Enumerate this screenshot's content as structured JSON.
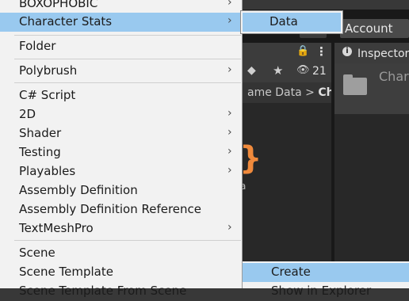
{
  "menu": {
    "items": [
      {
        "label": "BOXOPHOBIC",
        "arrow": "›"
      },
      {
        "label": "Character Stats",
        "arrow": "›"
      },
      {
        "label": "Folder",
        "arrow": ""
      },
      {
        "label": "Polybrush",
        "arrow": "›"
      },
      {
        "label": "C# Script",
        "arrow": ""
      },
      {
        "label": "2D",
        "arrow": "›"
      },
      {
        "label": "Shader",
        "arrow": "›"
      },
      {
        "label": "Testing",
        "arrow": "›"
      },
      {
        "label": "Playables",
        "arrow": "›"
      },
      {
        "label": "Assembly Definition",
        "arrow": ""
      },
      {
        "label": "Assembly Definition Reference",
        "arrow": ""
      },
      {
        "label": "TextMeshPro",
        "arrow": "›"
      },
      {
        "label": "Scene",
        "arrow": ""
      },
      {
        "label": "Scene Template",
        "arrow": ""
      },
      {
        "label": "Scene Template From Scene",
        "arrow": ""
      }
    ]
  },
  "submenu": {
    "label": "Data"
  },
  "bottom_submenu": {
    "label": "Create",
    "label2": "Show in Explorer"
  },
  "editor": {
    "account_label": "Account",
    "hidden_count": "21",
    "breadcrumb_prefix": "ame Data >",
    "breadcrumb_current": "Ch",
    "inspector_title": "Inspector",
    "inspector_name": "Chara",
    "asset_label": "a"
  },
  "colors": {
    "highlight": "#99c9ef",
    "menu_bg": "#f2f2f2",
    "accent_asset": "#f08a3c"
  }
}
